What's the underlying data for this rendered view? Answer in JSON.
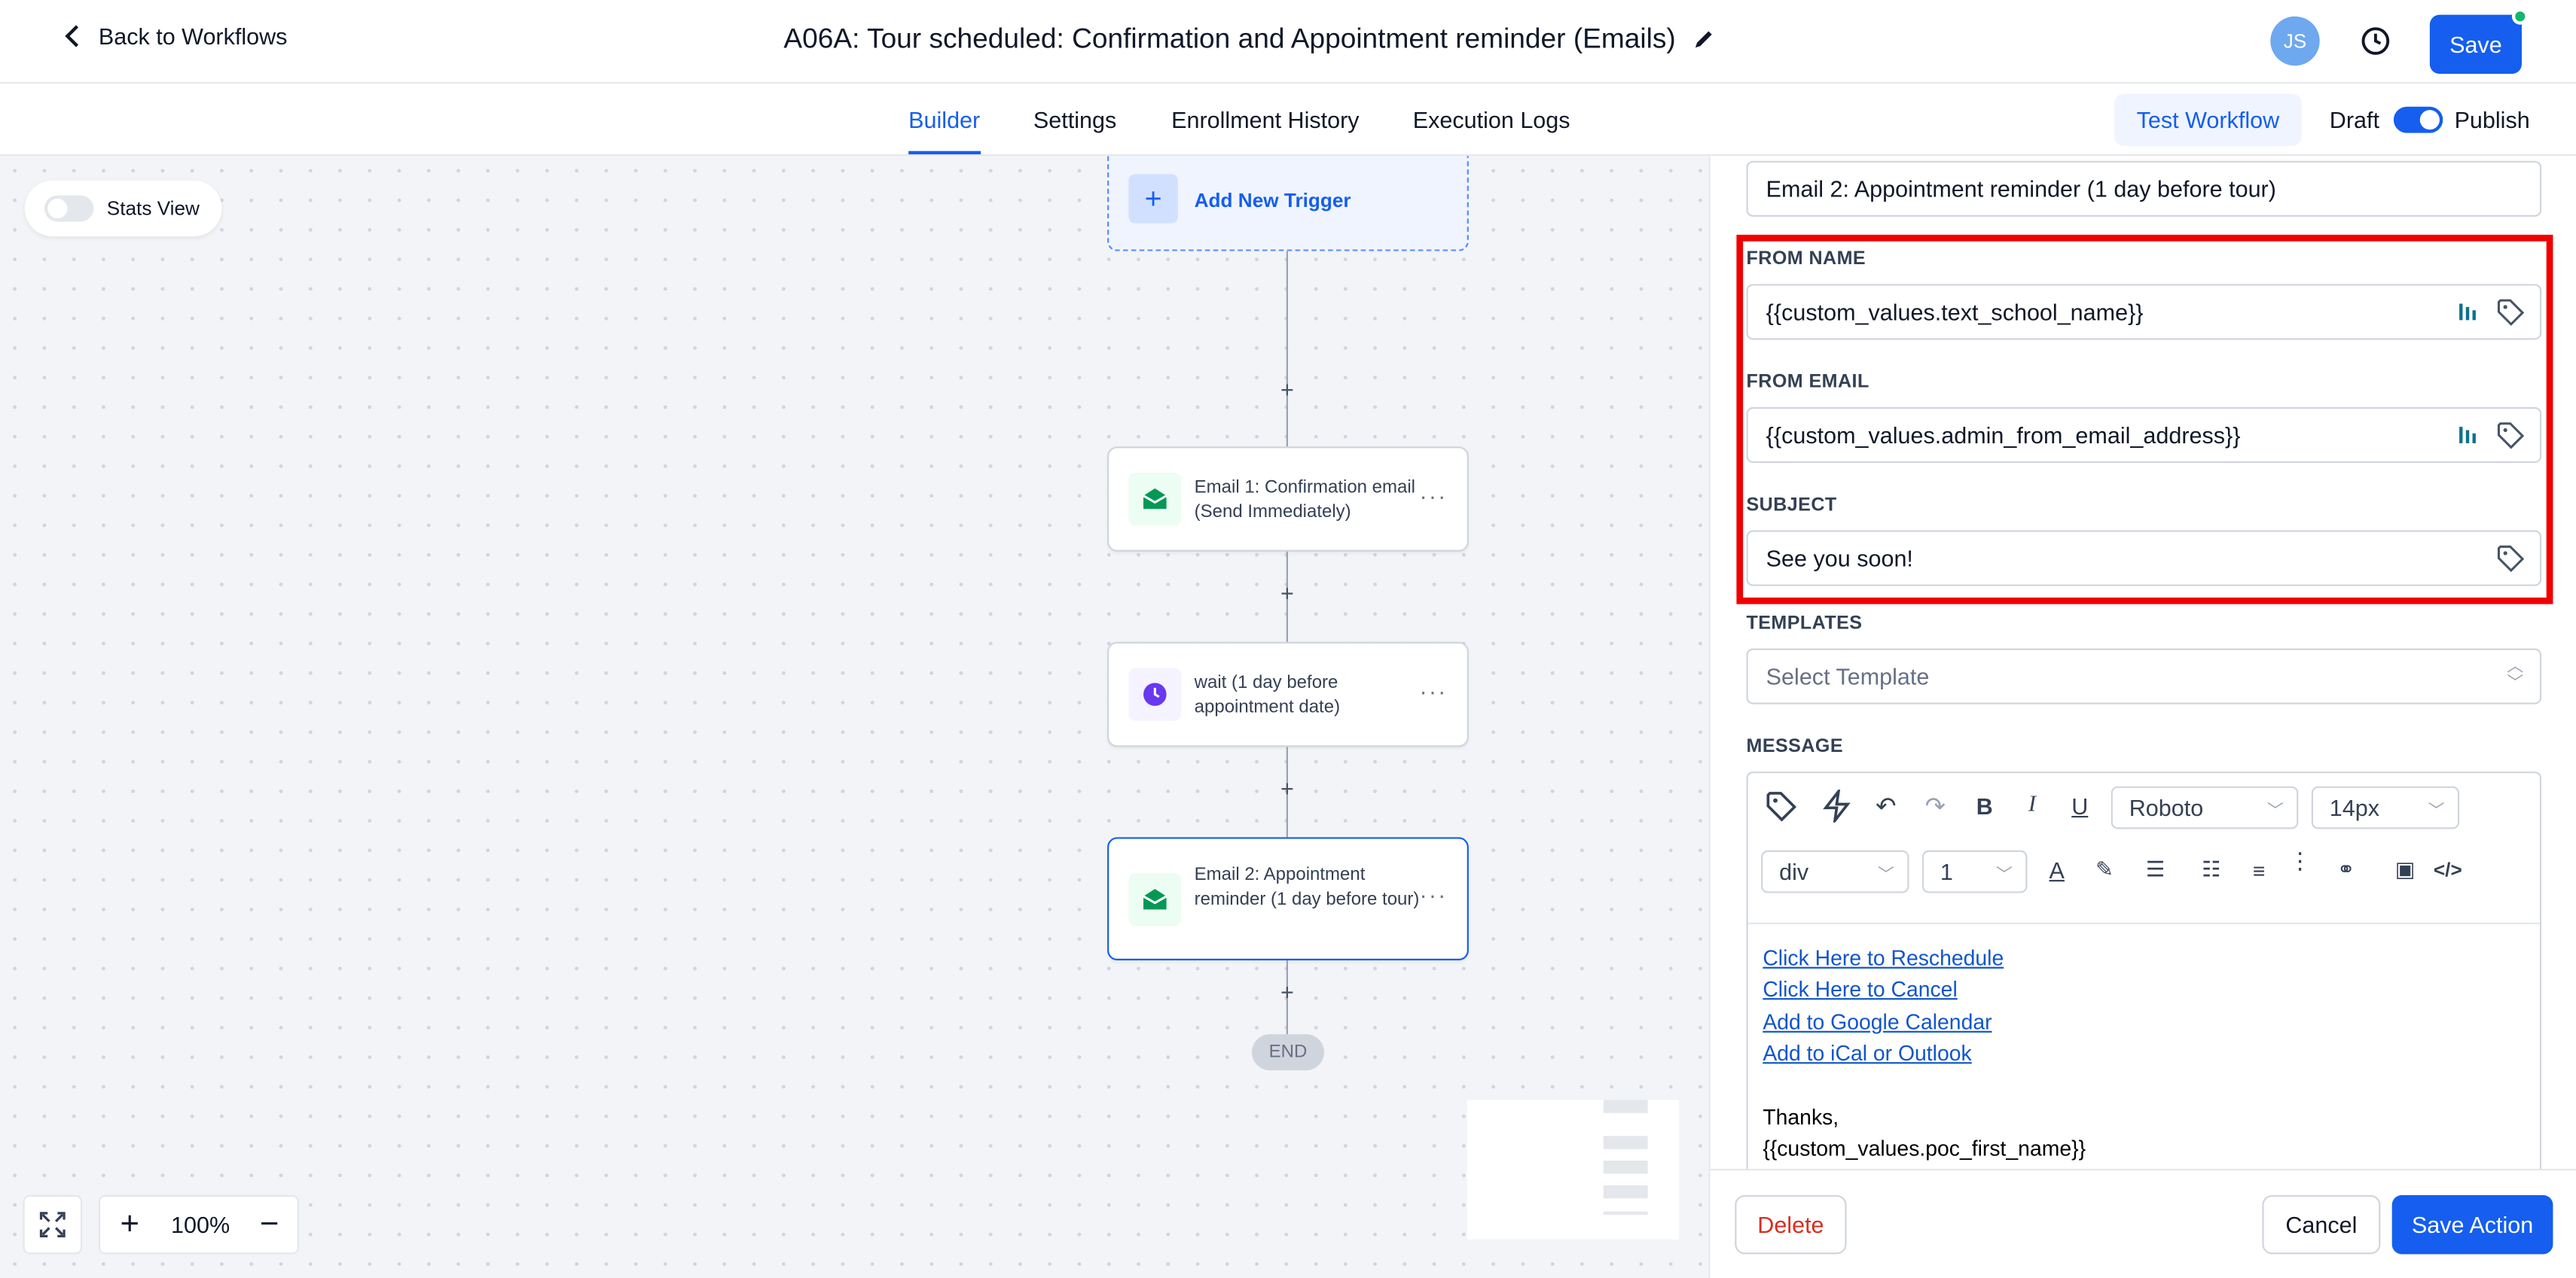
{
  "header": {
    "back_label": "Back to Workflows",
    "workflow_title": "A06A: Tour scheduled: Confirmation and Appointment reminder (Emails)",
    "avatar_initials": "JS",
    "save_label": "Save"
  },
  "tabs": [
    {
      "label": "Builder",
      "active": true
    },
    {
      "label": "Settings",
      "active": false
    },
    {
      "label": "Enrollment History",
      "active": false
    },
    {
      "label": "Execution Logs",
      "active": false
    }
  ],
  "actions": {
    "test_workflow": "Test Workflow",
    "draft_label": "Draft",
    "publish_label": "Publish",
    "published": true
  },
  "canvas": {
    "stats_view_label": "Stats View",
    "add_trigger_label": "Add New Trigger",
    "nodes": [
      {
        "text": "Email 1: Confirmation email (Send Immediately)",
        "type": "email"
      },
      {
        "text": "wait (1 day before appointment date)",
        "type": "wait"
      },
      {
        "text": "Email 2: Appointment reminder (1 day before tour)",
        "type": "email",
        "selected": true
      }
    ],
    "end_label": "END",
    "zoom_level": "100%"
  },
  "panel": {
    "action_name": "Email 2: Appointment reminder (1 day before tour)",
    "from_name_label": "FROM NAME",
    "from_name_value": "{{custom_values.text_school_name}}",
    "from_email_label": "FROM EMAIL",
    "from_email_value": "{{custom_values.admin_from_email_address}}",
    "subject_label": "SUBJECT",
    "subject_value": "See you soon!",
    "templates_label": "TEMPLATES",
    "templates_placeholder": "Select Template",
    "message_label": "MESSAGE",
    "toolbar": {
      "font": "Roboto",
      "font_size": "14px",
      "block": "div",
      "line_height": "1"
    },
    "body": {
      "links": [
        "Click Here to Reschedule",
        "Click Here to Cancel",
        "Add to Google Calendar",
        "Add to iCal or Outlook"
      ],
      "thanks": "Thanks,",
      "signature": "{{custom_values.poc_first_name}}"
    },
    "delete_label": "Delete",
    "cancel_label": "Cancel",
    "save_action_label": "Save Action"
  },
  "colors": {
    "primary": "#155eef",
    "highlight_box": "#f00000",
    "danger": "#d92d20",
    "email_icon": "#039855",
    "wait_icon": "#6938ef"
  }
}
